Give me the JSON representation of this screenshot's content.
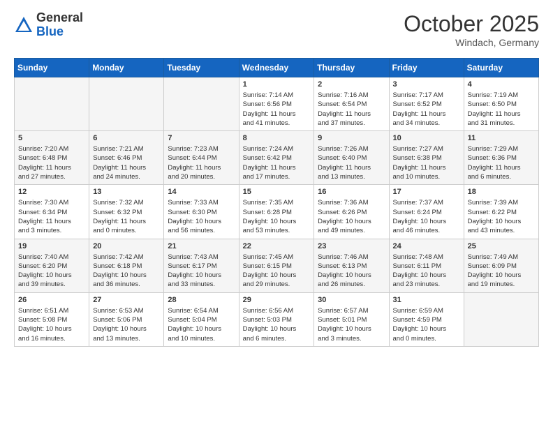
{
  "header": {
    "logo_general": "General",
    "logo_blue": "Blue",
    "month_year": "October 2025",
    "location": "Windach, Germany"
  },
  "weekdays": [
    "Sunday",
    "Monday",
    "Tuesday",
    "Wednesday",
    "Thursday",
    "Friday",
    "Saturday"
  ],
  "weeks": [
    [
      {
        "day": "",
        "info": ""
      },
      {
        "day": "",
        "info": ""
      },
      {
        "day": "",
        "info": ""
      },
      {
        "day": "1",
        "info": "Sunrise: 7:14 AM\nSunset: 6:56 PM\nDaylight: 11 hours\nand 41 minutes."
      },
      {
        "day": "2",
        "info": "Sunrise: 7:16 AM\nSunset: 6:54 PM\nDaylight: 11 hours\nand 37 minutes."
      },
      {
        "day": "3",
        "info": "Sunrise: 7:17 AM\nSunset: 6:52 PM\nDaylight: 11 hours\nand 34 minutes."
      },
      {
        "day": "4",
        "info": "Sunrise: 7:19 AM\nSunset: 6:50 PM\nDaylight: 11 hours\nand 31 minutes."
      }
    ],
    [
      {
        "day": "5",
        "info": "Sunrise: 7:20 AM\nSunset: 6:48 PM\nDaylight: 11 hours\nand 27 minutes."
      },
      {
        "day": "6",
        "info": "Sunrise: 7:21 AM\nSunset: 6:46 PM\nDaylight: 11 hours\nand 24 minutes."
      },
      {
        "day": "7",
        "info": "Sunrise: 7:23 AM\nSunset: 6:44 PM\nDaylight: 11 hours\nand 20 minutes."
      },
      {
        "day": "8",
        "info": "Sunrise: 7:24 AM\nSunset: 6:42 PM\nDaylight: 11 hours\nand 17 minutes."
      },
      {
        "day": "9",
        "info": "Sunrise: 7:26 AM\nSunset: 6:40 PM\nDaylight: 11 hours\nand 13 minutes."
      },
      {
        "day": "10",
        "info": "Sunrise: 7:27 AM\nSunset: 6:38 PM\nDaylight: 11 hours\nand 10 minutes."
      },
      {
        "day": "11",
        "info": "Sunrise: 7:29 AM\nSunset: 6:36 PM\nDaylight: 11 hours\nand 6 minutes."
      }
    ],
    [
      {
        "day": "12",
        "info": "Sunrise: 7:30 AM\nSunset: 6:34 PM\nDaylight: 11 hours\nand 3 minutes."
      },
      {
        "day": "13",
        "info": "Sunrise: 7:32 AM\nSunset: 6:32 PM\nDaylight: 11 hours\nand 0 minutes."
      },
      {
        "day": "14",
        "info": "Sunrise: 7:33 AM\nSunset: 6:30 PM\nDaylight: 10 hours\nand 56 minutes."
      },
      {
        "day": "15",
        "info": "Sunrise: 7:35 AM\nSunset: 6:28 PM\nDaylight: 10 hours\nand 53 minutes."
      },
      {
        "day": "16",
        "info": "Sunrise: 7:36 AM\nSunset: 6:26 PM\nDaylight: 10 hours\nand 49 minutes."
      },
      {
        "day": "17",
        "info": "Sunrise: 7:37 AM\nSunset: 6:24 PM\nDaylight: 10 hours\nand 46 minutes."
      },
      {
        "day": "18",
        "info": "Sunrise: 7:39 AM\nSunset: 6:22 PM\nDaylight: 10 hours\nand 43 minutes."
      }
    ],
    [
      {
        "day": "19",
        "info": "Sunrise: 7:40 AM\nSunset: 6:20 PM\nDaylight: 10 hours\nand 39 minutes."
      },
      {
        "day": "20",
        "info": "Sunrise: 7:42 AM\nSunset: 6:18 PM\nDaylight: 10 hours\nand 36 minutes."
      },
      {
        "day": "21",
        "info": "Sunrise: 7:43 AM\nSunset: 6:17 PM\nDaylight: 10 hours\nand 33 minutes."
      },
      {
        "day": "22",
        "info": "Sunrise: 7:45 AM\nSunset: 6:15 PM\nDaylight: 10 hours\nand 29 minutes."
      },
      {
        "day": "23",
        "info": "Sunrise: 7:46 AM\nSunset: 6:13 PM\nDaylight: 10 hours\nand 26 minutes."
      },
      {
        "day": "24",
        "info": "Sunrise: 7:48 AM\nSunset: 6:11 PM\nDaylight: 10 hours\nand 23 minutes."
      },
      {
        "day": "25",
        "info": "Sunrise: 7:49 AM\nSunset: 6:09 PM\nDaylight: 10 hours\nand 19 minutes."
      }
    ],
    [
      {
        "day": "26",
        "info": "Sunrise: 6:51 AM\nSunset: 5:08 PM\nDaylight: 10 hours\nand 16 minutes."
      },
      {
        "day": "27",
        "info": "Sunrise: 6:53 AM\nSunset: 5:06 PM\nDaylight: 10 hours\nand 13 minutes."
      },
      {
        "day": "28",
        "info": "Sunrise: 6:54 AM\nSunset: 5:04 PM\nDaylight: 10 hours\nand 10 minutes."
      },
      {
        "day": "29",
        "info": "Sunrise: 6:56 AM\nSunset: 5:03 PM\nDaylight: 10 hours\nand 6 minutes."
      },
      {
        "day": "30",
        "info": "Sunrise: 6:57 AM\nSunset: 5:01 PM\nDaylight: 10 hours\nand 3 minutes."
      },
      {
        "day": "31",
        "info": "Sunrise: 6:59 AM\nSunset: 4:59 PM\nDaylight: 10 hours\nand 0 minutes."
      },
      {
        "day": "",
        "info": ""
      }
    ]
  ]
}
